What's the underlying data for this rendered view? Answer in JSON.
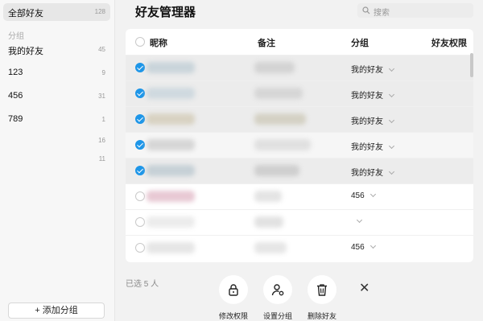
{
  "sidebar": {
    "all_friends": {
      "label": "全部好友",
      "count": "128"
    },
    "section_label": "分组",
    "groups": [
      {
        "label": "我的好友",
        "count": "45"
      },
      {
        "label": "123",
        "count": "9"
      },
      {
        "label": "456",
        "count": "31"
      },
      {
        "label": "789",
        "count": "1"
      },
      {
        "label": "",
        "count": "16"
      },
      {
        "label": "",
        "count": "11"
      }
    ],
    "add_group_label": "+ 添加分组"
  },
  "header": {
    "title": "好友管理器",
    "search_placeholder": "搜索"
  },
  "table": {
    "columns": {
      "nickname": "昵称",
      "note": "备注",
      "group": "分组",
      "permission": "好友权限"
    },
    "rows": [
      {
        "selected": true,
        "group": "我的好友"
      },
      {
        "selected": true,
        "group": "我的好友"
      },
      {
        "selected": true,
        "group": "我的好友"
      },
      {
        "selected": true,
        "group": "我的好友"
      },
      {
        "selected": true,
        "group": "我的好友"
      },
      {
        "selected": false,
        "group": "456"
      },
      {
        "selected": false,
        "group": ""
      },
      {
        "selected": false,
        "group": "456"
      }
    ]
  },
  "footer": {
    "selected_text": "已选 5 人",
    "actions": {
      "permission": "修改权限",
      "set_group": "设置分组",
      "delete": "删除好友"
    },
    "close_glyph": "✕"
  },
  "colors": {
    "accent": "#1e96e8"
  },
  "icons": [
    "search-icon",
    "lock-icon",
    "user-settings-icon",
    "trash-icon",
    "close-icon",
    "chevron-down-icon",
    "check-icon"
  ]
}
